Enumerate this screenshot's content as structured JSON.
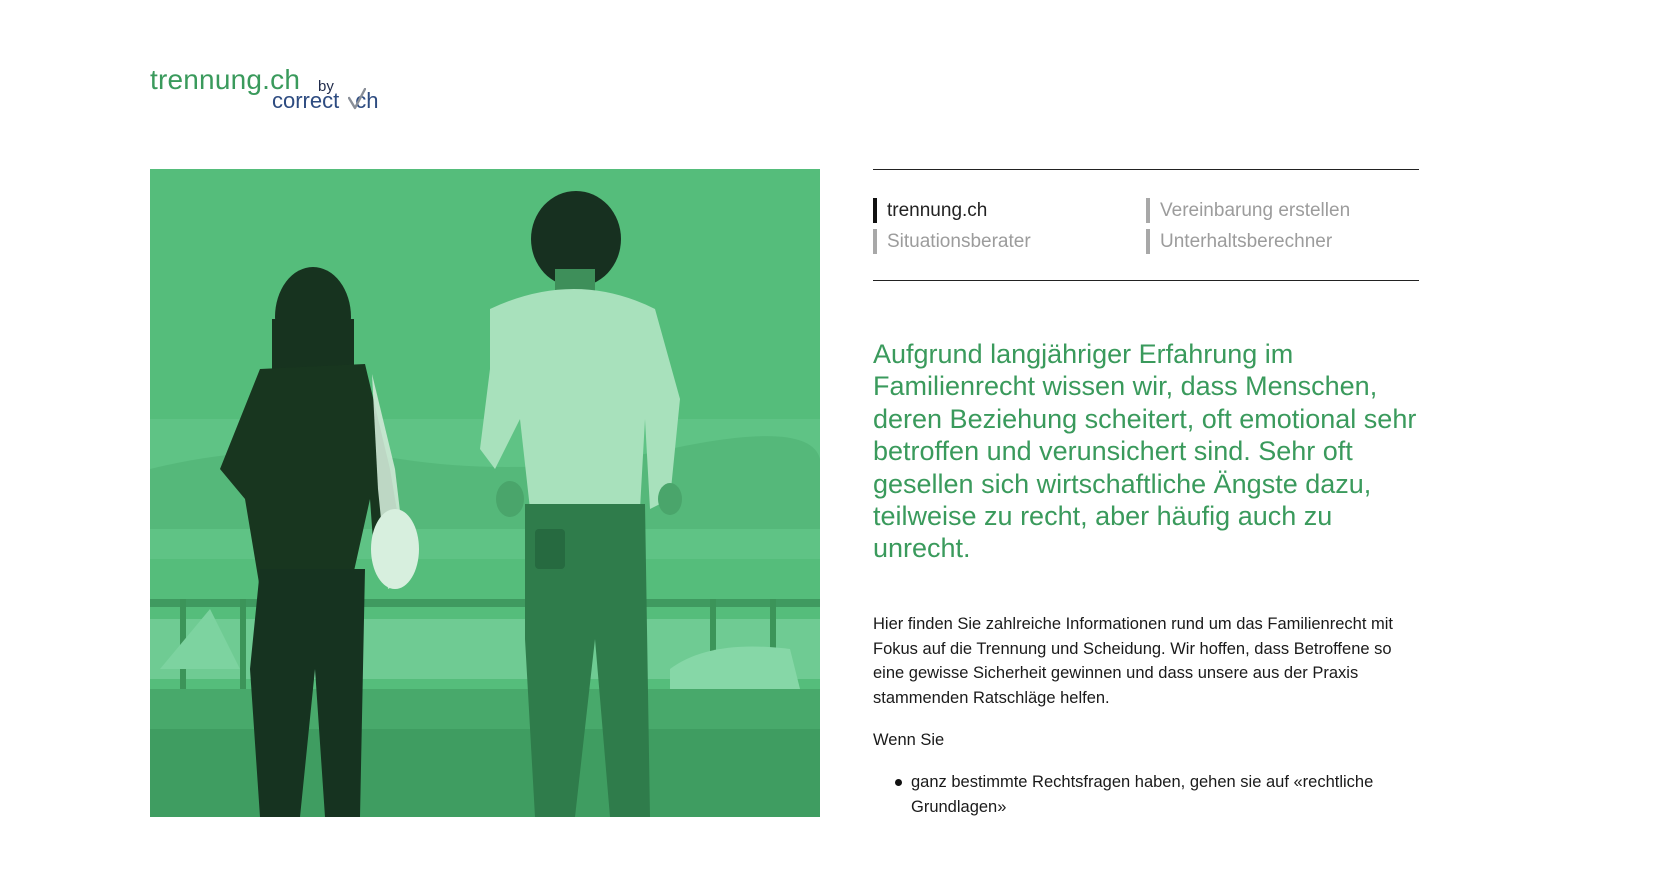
{
  "logo": {
    "brand": "trennung.ch",
    "by": "by",
    "sub_left": "correct",
    "sub_right": "ch"
  },
  "nav": {
    "items": [
      {
        "label": "trennung.ch",
        "active": true
      },
      {
        "label": "Vereinbarung erstellen",
        "active": false
      },
      {
        "label": "Situationsberater",
        "active": false
      },
      {
        "label": "Unterhaltsberechner",
        "active": false
      }
    ]
  },
  "main": {
    "lead": "Aufgrund langjähriger Erfahrung im Familienrecht wissen wir, dass Menschen, deren Beziehung scheitert, oft emotional sehr betroffen und verunsichert sind. Sehr oft gesellen sich wirtschaftliche Ängste dazu, teilweise zu recht, aber häufig auch zu unrecht.",
    "paragraph": "Hier finden Sie zahlreiche Informationen rund um das Familienrecht mit Fokus auf die Trennung und Scheidung. Wir hoffen, dass Betroffene so eine gewisse Sicherheit gewinnen und dass unsere aus der Praxis stammenden Ratschläge helfen.",
    "wenn": "Wenn Sie",
    "bullets": [
      "ganz bestimmte Rechtsfragen haben, gehen sie auf «rechtliche Grundlagen»"
    ]
  },
  "colors": {
    "brand_green": "#3a9a5c",
    "hero_tint": "#55bd7b",
    "logo_blue": "#2d4b80"
  }
}
